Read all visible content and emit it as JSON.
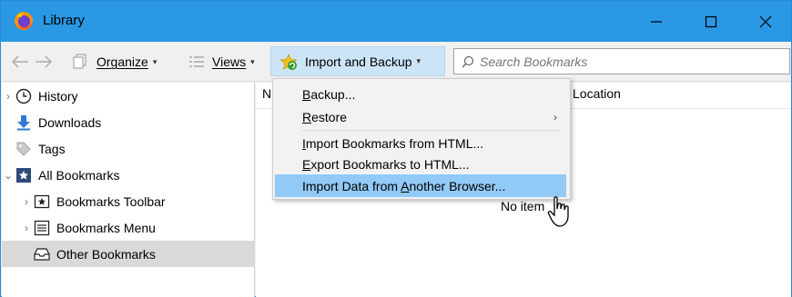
{
  "window": {
    "title": "Library",
    "controls": {
      "minimize": "—",
      "maximize": "☐",
      "close": "✕"
    },
    "accent_color": "#2b98e4"
  },
  "toolbar": {
    "back_icon": "back-arrow-icon",
    "forward_icon": "forward-arrow-icon",
    "organize_label": "Organize",
    "views_label": "Views",
    "import_backup_label": "Import and Backup",
    "search_placeholder": "Search Bookmarks",
    "caret": "▾"
  },
  "sidebar": {
    "items": [
      {
        "label": "History",
        "icon": "clock-icon",
        "twisty": "›"
      },
      {
        "label": "Downloads",
        "icon": "download-arrow-icon",
        "twisty": ""
      },
      {
        "label": "Tags",
        "icon": "tag-icon",
        "twisty": ""
      },
      {
        "label": "All Bookmarks",
        "icon": "bookmarks-folder-icon",
        "twisty": "⌄"
      },
      {
        "label": "Bookmarks Toolbar",
        "icon": "toolbar-star-icon",
        "twisty": "›"
      },
      {
        "label": "Bookmarks Menu",
        "icon": "menu-list-icon",
        "twisty": "›"
      },
      {
        "label": "Other Bookmarks",
        "icon": "tray-icon",
        "twisty": ""
      }
    ],
    "selected": "Other Bookmarks"
  },
  "content": {
    "column_name_partial": "N",
    "column_location": "Location",
    "empty_message": "No item"
  },
  "menu": {
    "backup": {
      "before": "",
      "ul": "B",
      "after": "ackup..."
    },
    "restore": {
      "before": "",
      "ul": "R",
      "after": "estore",
      "arrow": "›"
    },
    "import_html": {
      "before": "",
      "ul": "I",
      "after": "mport Bookmarks from HTML..."
    },
    "export_html": {
      "before": "",
      "ul": "E",
      "after": "xport Bookmarks to HTML..."
    },
    "import_browser": {
      "before": "Import Data from ",
      "ul": "A",
      "after": "nother Browser..."
    }
  }
}
